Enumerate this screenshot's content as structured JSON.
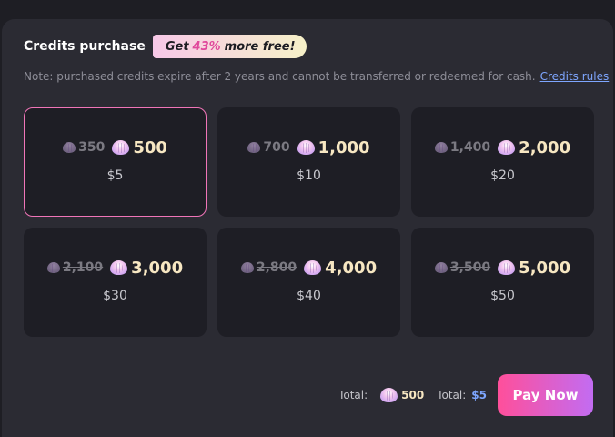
{
  "header": {
    "title": "Credits purchase",
    "promo_prefix": "Get",
    "promo_percent": "43%",
    "promo_suffix": "more free!"
  },
  "note": {
    "text": "Note: purchased credits expire after 2 years and cannot be transferred or redeemed for cash.",
    "link": "Credits rules"
  },
  "packages": [
    {
      "old": "350",
      "new": "500",
      "price": "$5",
      "selected": true
    },
    {
      "old": "700",
      "new": "1,000",
      "price": "$10"
    },
    {
      "old": "1,400",
      "new": "2,000",
      "price": "$20"
    },
    {
      "old": "2,100",
      "new": "3,000",
      "price": "$30"
    },
    {
      "old": "2,800",
      "new": "4,000",
      "price": "$40"
    },
    {
      "old": "3,500",
      "new": "5,000",
      "price": "$50"
    }
  ],
  "footer": {
    "total_label_1": "Total:",
    "total_credits": "500",
    "total_label_2": "Total:",
    "total_price": "$5",
    "pay_button": "Pay Now"
  },
  "colors": {
    "selected_border": "#f075b8",
    "accent_pink": "#ff4f9a",
    "accent_purple": "#c26cf2",
    "link_blue": "#7ea6ff",
    "credit_gold": "#f7e7c2"
  },
  "icons": {
    "credit": "shell-icon"
  }
}
